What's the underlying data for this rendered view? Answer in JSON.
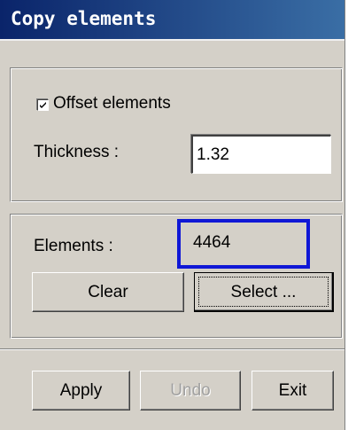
{
  "window": {
    "title": "Copy elements"
  },
  "offset_group": {
    "checkbox_label": "Offset elements",
    "checkbox_checked": true,
    "thickness_label": "Thickness :",
    "thickness_value": "1.32"
  },
  "elements_group": {
    "count_label": "Elements :",
    "count_value": "4464",
    "highlight_color": "#0f17d6",
    "clear_label": "Clear",
    "select_label": "Select ..."
  },
  "footer": {
    "apply_label": "Apply",
    "undo_label": "Undo",
    "undo_enabled": false,
    "exit_label": "Exit"
  },
  "colors": {
    "titlebar_start": "#0a246a",
    "titlebar_end": "#3a6ea5",
    "dialog_bg": "#d4d0c8"
  }
}
